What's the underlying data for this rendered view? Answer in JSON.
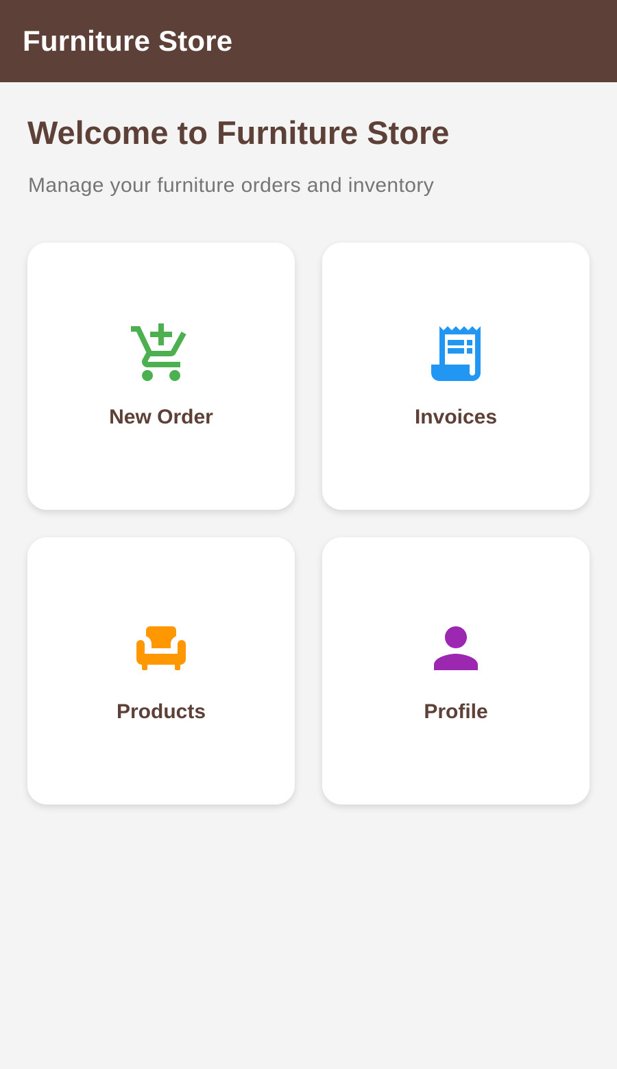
{
  "appbar": {
    "title": "Furniture Store"
  },
  "welcome": {
    "title": "Welcome to Furniture Store",
    "subtitle": "Manage your furniture orders and inventory"
  },
  "cards": [
    {
      "label": "New Order",
      "icon": "add-shopping-cart-icon",
      "color": "#4caf50"
    },
    {
      "label": "Invoices",
      "icon": "receipt-icon",
      "color": "#2196f3"
    },
    {
      "label": "Products",
      "icon": "armchair-icon",
      "color": "#ff9800"
    },
    {
      "label": "Profile",
      "icon": "person-icon",
      "color": "#9c27b0"
    }
  ]
}
